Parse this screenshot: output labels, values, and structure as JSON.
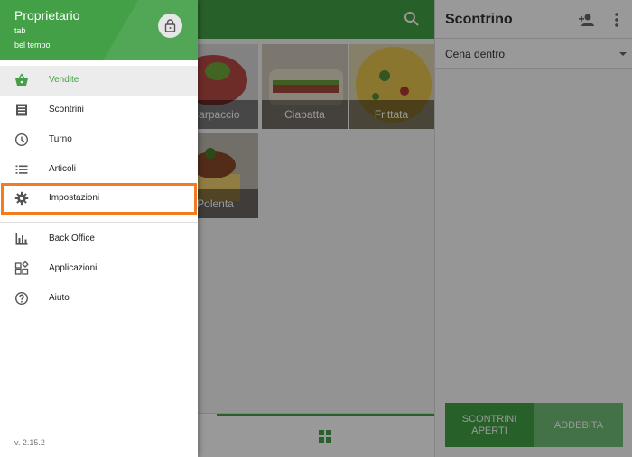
{
  "drawer": {
    "owner": "Proprietario",
    "pos_name": "tab",
    "store_name": "bel tempo",
    "version": "v. 2.15.2",
    "items": [
      {
        "label": "Vendite",
        "icon": "basket-icon"
      },
      {
        "label": "Scontrini",
        "icon": "receipt-icon"
      },
      {
        "label": "Turno",
        "icon": "clock-icon"
      },
      {
        "label": "Articoli",
        "icon": "list-icon"
      },
      {
        "label": "Impostazioni",
        "icon": "gear-icon"
      },
      {
        "label": "Back Office",
        "icon": "bar-chart-icon"
      },
      {
        "label": "Applicazioni",
        "icon": "apps-icon"
      },
      {
        "label": "Aiuto",
        "icon": "help-icon"
      }
    ]
  },
  "products": [
    {
      "name": "Carpaccio"
    },
    {
      "name": "Ciabatta"
    },
    {
      "name": "Frittata"
    },
    {
      "name": "Polenta"
    }
  ],
  "ticket": {
    "title": "Scontrino",
    "dining_option": "Cena dentro",
    "open_tickets_label": "SCONTRINI APERTI",
    "charge_label": "ADDEBITA"
  },
  "colors": {
    "accent": "#43a047",
    "highlight": "#f47b20"
  }
}
